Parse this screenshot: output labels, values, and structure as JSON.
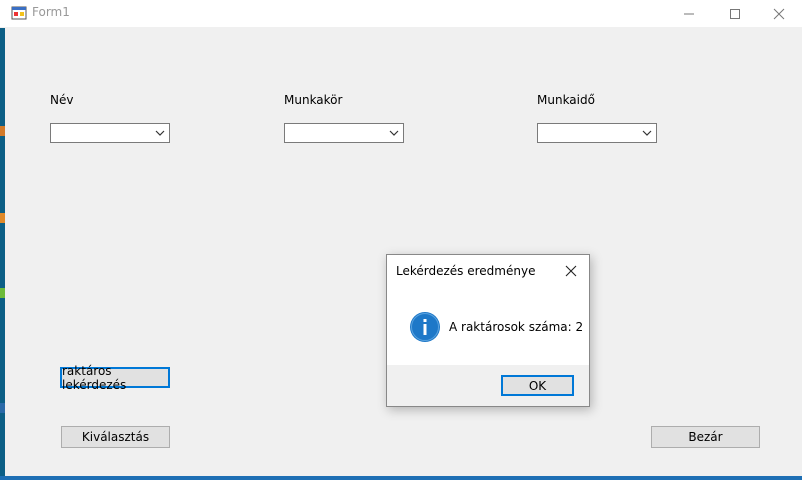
{
  "window": {
    "title": "Form1"
  },
  "form": {
    "labels": {
      "name": "Név",
      "job": "Munkakör",
      "worktime": "Munkaidő"
    },
    "combos": {
      "name": "",
      "job": "",
      "worktime": ""
    },
    "buttons": {
      "query": "raktáros lekérdezés",
      "select": "Kiválasztás",
      "close": "Bezár"
    }
  },
  "dialog": {
    "title": "Lekérdezés eredménye",
    "message": "A raktárosok száma: 2",
    "ok": "OK",
    "icon": "info-icon"
  },
  "colors": {
    "accent": "#0078d7",
    "info_blue": "#1e78c8"
  }
}
